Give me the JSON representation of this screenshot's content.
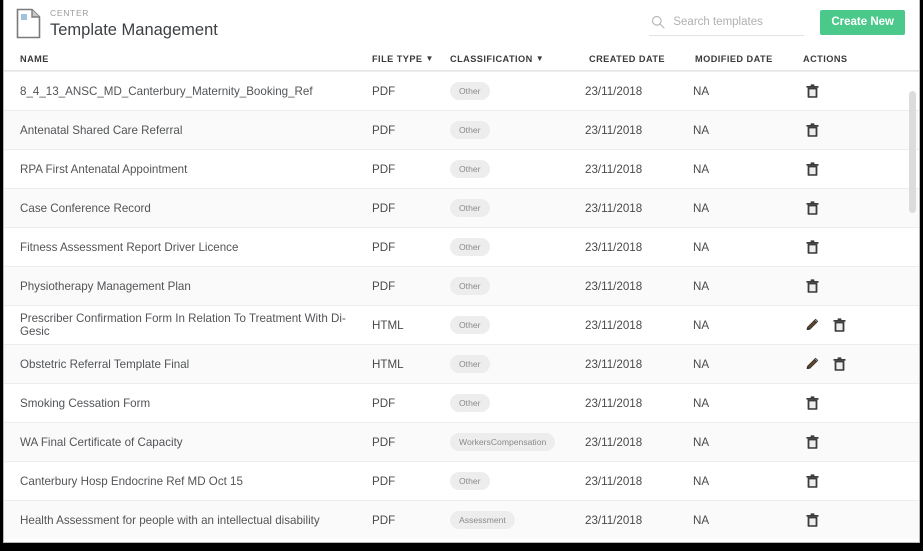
{
  "header": {
    "eyebrow": "CENTER",
    "title": "Template Management",
    "doc_icon": "document-icon"
  },
  "search": {
    "icon": "search-icon",
    "placeholder": "Search templates",
    "value": ""
  },
  "actions": {
    "create_new_label": "Create New",
    "create_new_color": "#4bc98a"
  },
  "table": {
    "columns": [
      {
        "key": "name",
        "label": "NAME",
        "filterable": false
      },
      {
        "key": "type",
        "label": "FILE TYPE",
        "filterable": true,
        "filter_glyph": "▼"
      },
      {
        "key": "class",
        "label": "CLASSIFICATION",
        "filterable": true,
        "filter_glyph": "▼"
      },
      {
        "key": "created",
        "label": "CREATED DATE",
        "filterable": false
      },
      {
        "key": "modified",
        "label": "MODIFIED DATE",
        "filterable": false
      },
      {
        "key": "actions",
        "label": "ACTIONS",
        "filterable": false
      }
    ],
    "rows": [
      {
        "name": "8_4_13_ANSC_MD_Canterbury_Maternity_Booking_Ref",
        "type": "PDF",
        "classification": "Other",
        "created": "23/11/2018",
        "modified": "NA",
        "can_edit": false
      },
      {
        "name": "Antenatal Shared Care Referral",
        "type": "PDF",
        "classification": "Other",
        "created": "23/11/2018",
        "modified": "NA",
        "can_edit": false
      },
      {
        "name": "RPA First Antenatal Appointment",
        "type": "PDF",
        "classification": "Other",
        "created": "23/11/2018",
        "modified": "NA",
        "can_edit": false
      },
      {
        "name": "Case Conference Record",
        "type": "PDF",
        "classification": "Other",
        "created": "23/11/2018",
        "modified": "NA",
        "can_edit": false
      },
      {
        "name": "Fitness Assessment Report Driver Licence",
        "type": "PDF",
        "classification": "Other",
        "created": "23/11/2018",
        "modified": "NA",
        "can_edit": false
      },
      {
        "name": "Physiotherapy Management Plan",
        "type": "PDF",
        "classification": "Other",
        "created": "23/11/2018",
        "modified": "NA",
        "can_edit": false
      },
      {
        "name": "Prescriber Confirmation Form In Relation To Treatment With Di-Gesic",
        "type": "HTML",
        "classification": "Other",
        "created": "23/11/2018",
        "modified": "NA",
        "can_edit": true
      },
      {
        "name": "Obstetric Referral Template Final",
        "type": "HTML",
        "classification": "Other",
        "created": "23/11/2018",
        "modified": "NA",
        "can_edit": true
      },
      {
        "name": "Smoking Cessation Form",
        "type": "PDF",
        "classification": "Other",
        "created": "23/11/2018",
        "modified": "NA",
        "can_edit": false
      },
      {
        "name": "WA Final Certificate of Capacity",
        "type": "PDF",
        "classification": "WorkersCompensation",
        "created": "23/11/2018",
        "modified": "NA",
        "can_edit": false
      },
      {
        "name": "Canterbury Hosp Endocrine Ref MD Oct 15",
        "type": "PDF",
        "classification": "Other",
        "created": "23/11/2018",
        "modified": "NA",
        "can_edit": false
      },
      {
        "name": "Health Assessment for people with an intellectual disability",
        "type": "PDF",
        "classification": "Assessment",
        "created": "23/11/2018",
        "modified": "NA",
        "can_edit": false
      }
    ],
    "icons": {
      "edit": "pencil-icon",
      "delete": "trash-icon"
    }
  },
  "scrollbar": {
    "visible": true
  }
}
